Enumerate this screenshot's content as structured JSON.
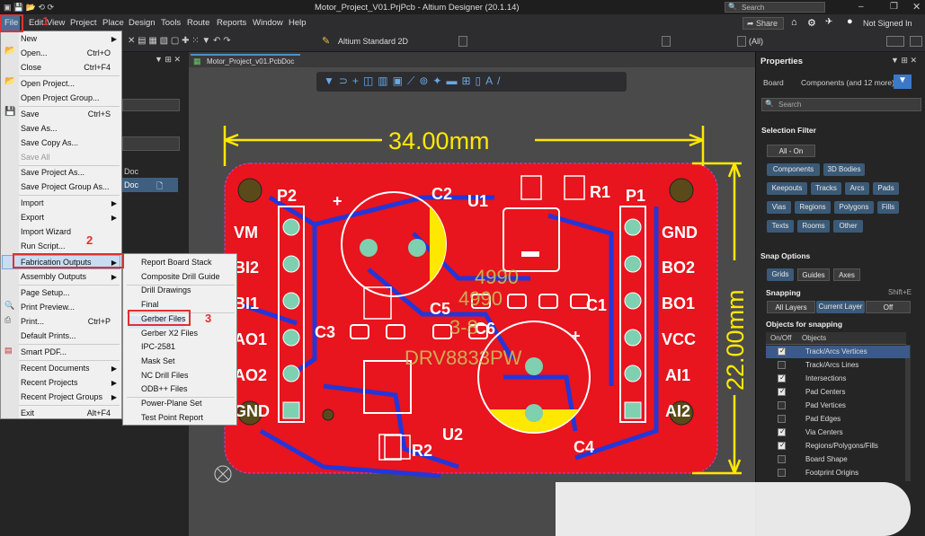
{
  "titlebar": {
    "title": "Motor_Project_V01.PrjPcb - Altium Designer (20.1.14)",
    "search": "Search"
  },
  "menu": [
    "File",
    "Edit",
    "View",
    "Project",
    "Place",
    "Design",
    "Tools",
    "Route",
    "Reports",
    "Window",
    "Help"
  ],
  "topright": {
    "share": "Share",
    "signin": "Not Signed In"
  },
  "toolbar": {
    "layerstack": "Altium Standard 2D",
    "all": "(All)"
  },
  "doctab": "Motor_Project_v01.PcbDoc",
  "leftpanel": {
    "doc1": "Doc",
    "doc2": "Doc"
  },
  "filemenu": {
    "items": [
      {
        "label": "New",
        "arrow": true
      },
      {
        "label": "Open...",
        "shortcut": "Ctrl+O"
      },
      {
        "label": "Close",
        "shortcut": "Ctrl+F4"
      },
      {
        "label": "Open Project..."
      },
      {
        "label": "Open Project Group..."
      },
      {
        "label": "Save",
        "shortcut": "Ctrl+S"
      },
      {
        "label": "Save As..."
      },
      {
        "label": "Save Copy As..."
      },
      {
        "label": "Save All"
      },
      {
        "label": "Save Project As..."
      },
      {
        "label": "Save Project Group As..."
      },
      {
        "label": "Import",
        "arrow": true
      },
      {
        "label": "Export",
        "arrow": true
      },
      {
        "label": "Import Wizard"
      },
      {
        "label": "Run Script..."
      },
      {
        "label": "Fabrication Outputs",
        "arrow": true
      },
      {
        "label": "Assembly Outputs",
        "arrow": true
      },
      {
        "label": "Page Setup..."
      },
      {
        "label": "Print Preview..."
      },
      {
        "label": "Print...",
        "shortcut": "Ctrl+P"
      },
      {
        "label": "Default Prints..."
      },
      {
        "label": "Smart PDF..."
      },
      {
        "label": "Recent Documents",
        "arrow": true
      },
      {
        "label": "Recent Projects",
        "arrow": true
      },
      {
        "label": "Recent Project Groups",
        "arrow": true
      },
      {
        "label": "Exit",
        "shortcut": "Alt+F4"
      }
    ]
  },
  "submenu": [
    "Report Board Stack",
    "Composite Drill Guide",
    "Drill Drawings",
    "Final",
    "Gerber Files",
    "Gerber X2 Files",
    "IPC-2581",
    "Mask Set",
    "NC Drill Files",
    "ODB++ Files",
    "Power-Plane Set",
    "Test Point Report"
  ],
  "annotations": {
    "n1": "1",
    "n2": "2",
    "n3": "3"
  },
  "pcb": {
    "dim_h": "34.00mm",
    "dim_v": "22.00mm",
    "labels": [
      "P2",
      "C2",
      "U1",
      "R1",
      "P1",
      "VM",
      "GND",
      "BI2",
      "BO2",
      "BI1",
      "BO1",
      "AO1",
      "VCC",
      "AO2",
      "AI1",
      "GND",
      "AI2",
      "C3",
      "C5",
      "C6",
      "C1",
      "R2",
      "U2",
      "C4"
    ],
    "silk": [
      "4990",
      "4990",
      "3-8",
      "DRV8833PW"
    ]
  },
  "props": {
    "title": "Properties",
    "board": "Board",
    "components": "Components (and 12 more)",
    "search": "Search",
    "selection_filter": "Selection Filter",
    "all_on": "All - On",
    "filters": [
      "Components",
      "3D Bodies",
      "Keepouts",
      "Tracks",
      "Arcs",
      "Pads",
      "Vias",
      "Regions",
      "Polygons",
      "Fills",
      "Texts",
      "Rooms",
      "Other"
    ],
    "snap_options": "Snap Options",
    "grids": "Grids",
    "guides": "Guides",
    "axes": "Axes",
    "snapping": "Snapping",
    "snapping_shortcut": "Shift+E",
    "all_layers": "All Layers",
    "current_layer": "Current Layer",
    "off": "Off",
    "objects_for_snapping": "Objects for snapping",
    "col_onoff": "On/Off",
    "col_objects": "Objects",
    "objects": [
      {
        "name": "Track/Arcs Vertices",
        "on": true
      },
      {
        "name": "Track/Arcs Lines",
        "on": false
      },
      {
        "name": "Intersections",
        "on": true
      },
      {
        "name": "Pad Centers",
        "on": true
      },
      {
        "name": "Pad Vertices",
        "on": false
      },
      {
        "name": "Pad Edges",
        "on": false
      },
      {
        "name": "Via Centers",
        "on": true
      },
      {
        "name": "Regions/Polygons/Fills",
        "on": true
      },
      {
        "name": "Board Shape",
        "on": false
      },
      {
        "name": "Footprint Origins",
        "on": false
      }
    ]
  }
}
